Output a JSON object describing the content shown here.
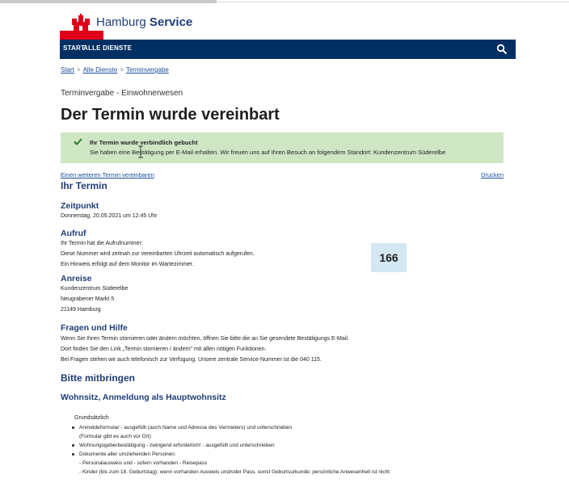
{
  "header": {
    "brand_light": "Hamburg",
    "brand_bold": "Service"
  },
  "nav": {
    "start": "START",
    "all_services": "ALLE DIENSTE",
    "search_icon": "search-icon"
  },
  "breadcrumb": {
    "items": [
      "Start",
      "Alle Dienste",
      "Terminvergabe"
    ],
    "separator": ">"
  },
  "page": {
    "subtitle": "Terminvergabe - Einwohnerwesen",
    "title": "Der Termin wurde vereinbart"
  },
  "success": {
    "title": "Ihr Termin wurde verbindlich gebucht",
    "text": "Sie haben eine Bestätigung per E-Mail erhalten. Wir freuen uns auf Ihren Besuch an folgendem Standort: Kundenzentrum Süderelbe",
    "color": "#cfe6c5"
  },
  "links": {
    "another": "Einen weiteren Termin vereinbaren",
    "print": "Drucken"
  },
  "appointment": {
    "heading": "Ihr Termin",
    "time_heading": "Zeitpunkt",
    "time_value": "Donnerstag, 20.05.2021 um 12:45 Uhr",
    "call_heading": "Aufruf",
    "call_lines": [
      "Ihr Termin hat die Aufrufnummer:",
      "Diese Nummer wird zeitnah zur vereinbarten Uhrzeit automatisch aufgerufen.",
      "Ein Hinweis erfolgt auf dem Monitor im Wartezimmer."
    ],
    "call_number": "166",
    "route_heading": "Anreise",
    "route_lines": [
      "Kundenzentrum Süderelbe",
      "Neugrabener Markt 5",
      "21149 Hamburg"
    ],
    "help_heading": "Fragen und Hilfe",
    "help_lines": [
      "Wenn Sie Ihren Termin stornieren oder ändern möchten, öffnen Sie bitte die an Sie gesendete Bestätigungs E-Mail.",
      "Dort finden Sie den Link „Termin stornieren / ändern“ mit allen nötigen Funktionen.",
      "Bei Fragen stehen wir auch telefonisch zur Verfügung. Unsere zentrale Service-Nummer ist die 040 115."
    ]
  },
  "bring": {
    "heading": "Bitte mitbringen",
    "subheading": "Wohnsitz, Anmeldung als Hauptwohnsitz",
    "intro": "Grundsätzlich",
    "items": [
      "Anmeldeformular - ausgefüllt (auch Name und Adresse des Vermieters) und unterschrieben",
      "Wohnungsgeberbestätigung - zwingend erforderlich! - ausgefüllt und unterschrieben",
      "Dokumente aller umziehenden Personen:"
    ],
    "item1_note": "(Formular gibt es auch vor Ort)",
    "sub_items": [
      "- Personalausweis und - sofern vorhanden - Reisepass",
      "- Kinder (bis zum 18. Geburtstag): wenn vorhanden Ausweis und/oder Pass, sonst Geburtsurkunde; persönliche Anwesenheit ist nicht"
    ]
  },
  "colors": {
    "nav_blue": "#003063",
    "brand_red": "#e10019",
    "heading_blue": "#1f3d7a",
    "number_bg": "#d4e8f3"
  }
}
